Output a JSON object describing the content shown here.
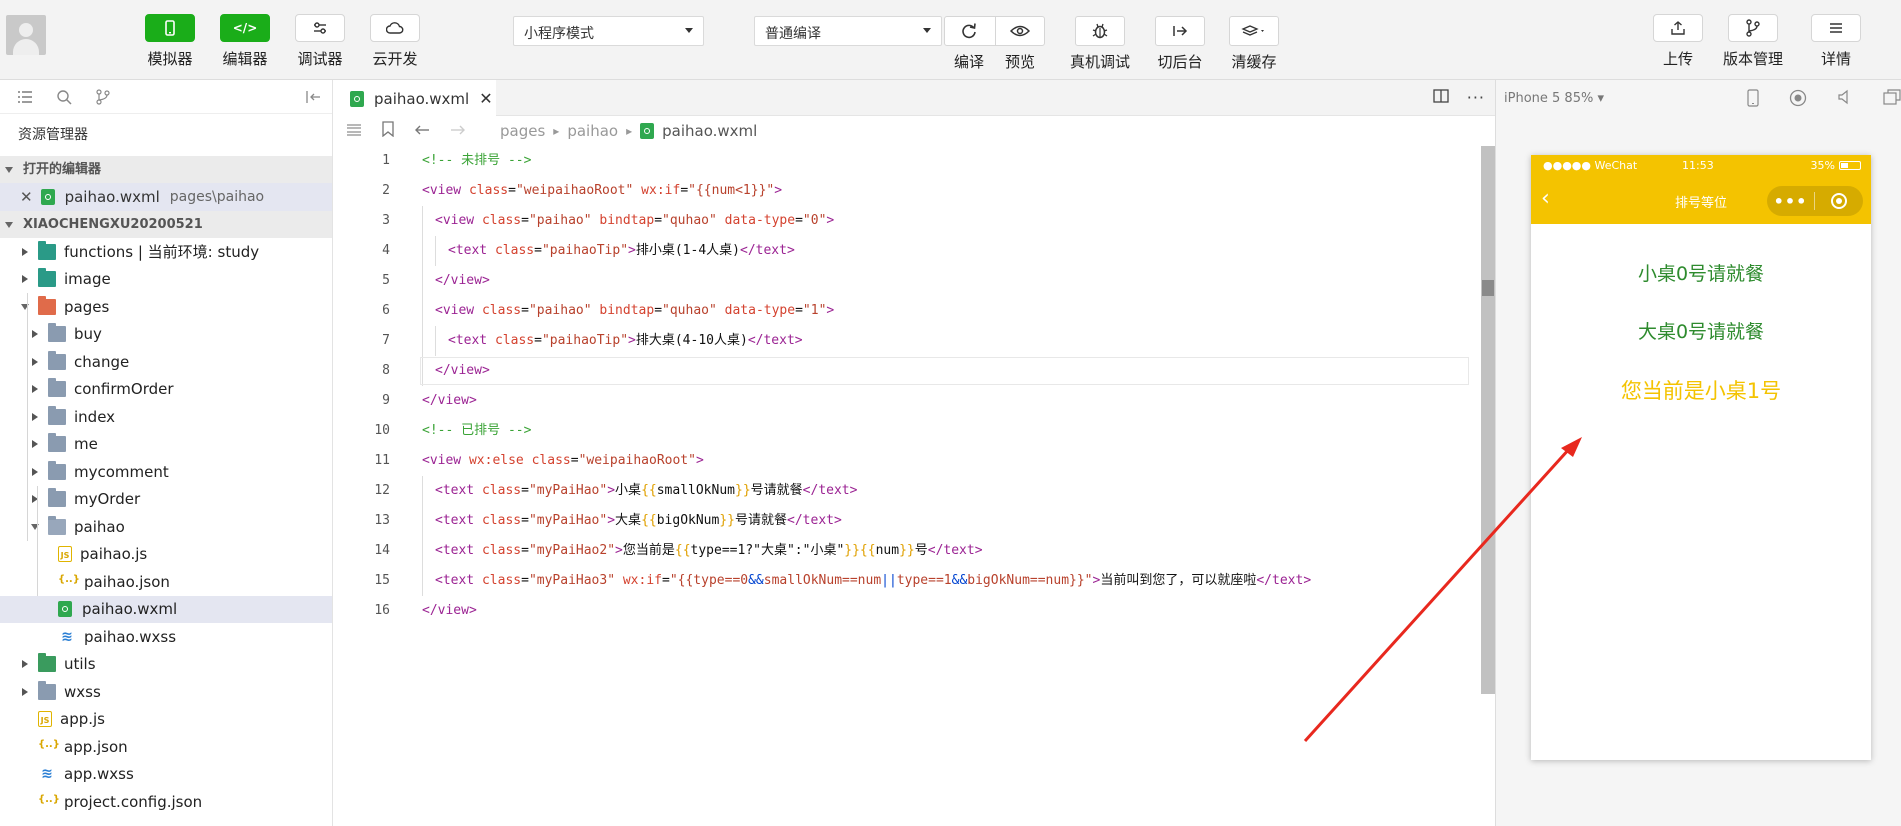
{
  "toolbar": {
    "mode_buttons": [
      {
        "label": "模拟器",
        "icon": "phone-icon"
      },
      {
        "label": "编辑器",
        "icon": "code-icon"
      },
      {
        "label": "调试器",
        "icon": "debug-sliders-icon"
      },
      {
        "label": "云开发",
        "icon": "cloud-icon"
      }
    ],
    "mode_select": "小程序模式",
    "compile_select": "普通编译",
    "actions": [
      {
        "label": "编译",
        "icon": "refresh-icon"
      },
      {
        "label": "预览",
        "icon": "eye-icon"
      },
      {
        "label": "真机调试",
        "icon": "bug-icon"
      },
      {
        "label": "切后台",
        "icon": "switch-background-icon"
      },
      {
        "label": "清缓存",
        "icon": "layers-icon"
      }
    ],
    "right_buttons": [
      {
        "label": "上传",
        "icon": "upload-icon"
      },
      {
        "label": "版本管理",
        "icon": "branch-icon"
      },
      {
        "label": "详情",
        "icon": "menu-icon"
      }
    ],
    "accent_color": "#1aad19"
  },
  "sidebar": {
    "title": "资源管理器",
    "open_editors_label": "打开的编辑器",
    "open_editor": {
      "name": "paihao.wxml",
      "path": "pages\\paihao"
    },
    "project_label": "XIAOCHENGXU20200521",
    "tree": [
      {
        "name": "functions | 当前环境: study",
        "kind": "folder-teal",
        "depth": 0,
        "expanded": false
      },
      {
        "name": "image",
        "kind": "folder-teal",
        "depth": 0,
        "expanded": false
      },
      {
        "name": "pages",
        "kind": "folder-orange",
        "depth": 0,
        "expanded": true
      },
      {
        "name": "buy",
        "kind": "folder",
        "depth": 1,
        "expanded": false
      },
      {
        "name": "change",
        "kind": "folder",
        "depth": 1,
        "expanded": false
      },
      {
        "name": "confirmOrder",
        "kind": "folder",
        "depth": 1,
        "expanded": false
      },
      {
        "name": "index",
        "kind": "folder",
        "depth": 1,
        "expanded": false
      },
      {
        "name": "me",
        "kind": "folder",
        "depth": 1,
        "expanded": false
      },
      {
        "name": "mycomment",
        "kind": "folder",
        "depth": 1,
        "expanded": false
      },
      {
        "name": "myOrder",
        "kind": "folder",
        "depth": 1,
        "expanded": false
      },
      {
        "name": "paihao",
        "kind": "folder-open",
        "depth": 1,
        "expanded": true
      },
      {
        "name": "paihao.js",
        "kind": "js",
        "depth": 2
      },
      {
        "name": "paihao.json",
        "kind": "json",
        "depth": 2
      },
      {
        "name": "paihao.wxml",
        "kind": "wxml",
        "depth": 2,
        "selected": true
      },
      {
        "name": "paihao.wxss",
        "kind": "wxss",
        "depth": 2
      },
      {
        "name": "utils",
        "kind": "folder-green",
        "depth": 0,
        "expanded": false
      },
      {
        "name": "wxss",
        "kind": "folder",
        "depth": 0,
        "expanded": false
      },
      {
        "name": "app.js",
        "kind": "js",
        "depth": 0
      },
      {
        "name": "app.json",
        "kind": "json",
        "depth": 0
      },
      {
        "name": "app.wxss",
        "kind": "wxss",
        "depth": 0
      },
      {
        "name": "project.config.json",
        "kind": "json",
        "depth": 0
      }
    ]
  },
  "editor": {
    "tab": "paihao.wxml",
    "breadcrumb": [
      "pages",
      "paihao",
      "paihao.wxml"
    ],
    "lines": [
      [
        [
          "cmt",
          "<!-- 未排号 -->"
        ]
      ],
      [
        [
          "tag",
          "<view "
        ],
        [
          "aname",
          "class"
        ],
        [
          "txt",
          "="
        ],
        [
          "str",
          "\"weipaihaoRoot\""
        ],
        [
          "txt",
          " "
        ],
        [
          "aname",
          "wx:if"
        ],
        [
          "txt",
          "="
        ],
        [
          "str",
          "\"{{num<1}}\""
        ],
        [
          "tag",
          ">"
        ]
      ],
      [
        [
          "ind",
          ""
        ],
        [
          "tag",
          "<view "
        ],
        [
          "aname",
          "class"
        ],
        [
          "txt",
          "="
        ],
        [
          "str",
          "\"paihao\""
        ],
        [
          "txt",
          " "
        ],
        [
          "aname",
          "bindtap"
        ],
        [
          "txt",
          "="
        ],
        [
          "str",
          "\"quhao\""
        ],
        [
          "txt",
          " "
        ],
        [
          "aname",
          "data-type"
        ],
        [
          "txt",
          "="
        ],
        [
          "str",
          "\"0\""
        ],
        [
          "tag",
          ">"
        ]
      ],
      [
        [
          "ind",
          ""
        ],
        [
          "ind",
          ""
        ],
        [
          "tag",
          "<text "
        ],
        [
          "aname",
          "class"
        ],
        [
          "txt",
          "="
        ],
        [
          "str",
          "\"paihaoTip\""
        ],
        [
          "tag",
          ">"
        ],
        [
          "txt",
          "排小桌(1-4人桌)"
        ],
        [
          "tag",
          "</text>"
        ]
      ],
      [
        [
          "ind",
          ""
        ],
        [
          "tag",
          "</view>"
        ]
      ],
      [
        [
          "ind",
          ""
        ],
        [
          "tag",
          "<view "
        ],
        [
          "aname",
          "class"
        ],
        [
          "txt",
          "="
        ],
        [
          "str",
          "\"paihao\""
        ],
        [
          "txt",
          " "
        ],
        [
          "aname",
          "bindtap"
        ],
        [
          "txt",
          "="
        ],
        [
          "str",
          "\"quhao\""
        ],
        [
          "txt",
          " "
        ],
        [
          "aname",
          "data-type"
        ],
        [
          "txt",
          "="
        ],
        [
          "str",
          "\"1\""
        ],
        [
          "tag",
          ">"
        ]
      ],
      [
        [
          "ind",
          ""
        ],
        [
          "ind",
          ""
        ],
        [
          "tag",
          "<text "
        ],
        [
          "aname",
          "class"
        ],
        [
          "txt",
          "="
        ],
        [
          "str",
          "\"paihaoTip\""
        ],
        [
          "tag",
          ">"
        ],
        [
          "txt",
          "排大桌(4-10人桌)"
        ],
        [
          "tag",
          "</text>"
        ]
      ],
      [
        [
          "ind",
          ""
        ],
        [
          "tag",
          "</view>"
        ]
      ],
      [
        [
          "tag",
          "</view>"
        ]
      ],
      [
        [
          "cmt",
          "<!-- 已排号 -->"
        ]
      ],
      [
        [
          "tag",
          "<view "
        ],
        [
          "aname",
          "wx:else"
        ],
        [
          "txt",
          " "
        ],
        [
          "aname",
          "class"
        ],
        [
          "txt",
          "="
        ],
        [
          "str",
          "\"weipaihaoRoot\""
        ],
        [
          "tag",
          ">"
        ]
      ],
      [
        [
          "ind",
          ""
        ],
        [
          "tag",
          "<text "
        ],
        [
          "aname",
          "class"
        ],
        [
          "txt",
          "="
        ],
        [
          "str",
          "\"myPaiHao\""
        ],
        [
          "tag",
          ">"
        ],
        [
          "txt",
          "小桌"
        ],
        [
          "br",
          "{{"
        ],
        [
          "txt",
          "smallOkNum"
        ],
        [
          "br",
          "}}"
        ],
        [
          "txt",
          "号请就餐"
        ],
        [
          "tag",
          "</text>"
        ]
      ],
      [
        [
          "ind",
          ""
        ],
        [
          "tag",
          "<text "
        ],
        [
          "aname",
          "class"
        ],
        [
          "txt",
          "="
        ],
        [
          "str",
          "\"myPaiHao\""
        ],
        [
          "tag",
          ">"
        ],
        [
          "txt",
          "大桌"
        ],
        [
          "br",
          "{{"
        ],
        [
          "txt",
          "bigOkNum"
        ],
        [
          "br",
          "}}"
        ],
        [
          "txt",
          "号请就餐"
        ],
        [
          "tag",
          "</text>"
        ]
      ],
      [
        [
          "ind",
          ""
        ],
        [
          "tag",
          "<text "
        ],
        [
          "aname",
          "class"
        ],
        [
          "txt",
          "="
        ],
        [
          "str",
          "\"myPaiHao2\""
        ],
        [
          "tag",
          ">"
        ],
        [
          "txt",
          "您当前是"
        ],
        [
          "br",
          "{{"
        ],
        [
          "txt",
          "type==1?\"大桌\":\"小桌\""
        ],
        [
          "br",
          "}}{{"
        ],
        [
          "txt",
          "num"
        ],
        [
          "br",
          "}}"
        ],
        [
          "txt",
          "号"
        ],
        [
          "tag",
          "</text>"
        ]
      ],
      [
        [
          "ind",
          ""
        ],
        [
          "tag",
          "<text "
        ],
        [
          "aname",
          "class"
        ],
        [
          "txt",
          "="
        ],
        [
          "str",
          "\"myPaiHao3\""
        ],
        [
          "txt",
          " "
        ],
        [
          "aname",
          "wx:if"
        ],
        [
          "txt",
          "="
        ],
        [
          "str",
          "\"{{type==0"
        ],
        [
          "op",
          "&&"
        ],
        [
          "str",
          "smallOkNum==num"
        ],
        [
          "op",
          "||"
        ],
        [
          "str",
          "type==1"
        ],
        [
          "op",
          "&&"
        ],
        [
          "str",
          "bigOkNum==num}}\""
        ],
        [
          "tag",
          ">"
        ],
        [
          "txt",
          "当前叫到您了，可以就座啦"
        ],
        [
          "tag",
          "</text>"
        ]
      ],
      [
        [
          "tag",
          "</view>"
        ]
      ]
    ],
    "active_line": 8
  },
  "simulator": {
    "device": "iPhone 5 85%",
    "status_left": "●●●●● WeChat",
    "status_time": "11:53",
    "status_battery": "35%",
    "nav_title": "排号等位",
    "texts": [
      {
        "text": "小桌0号请就餐",
        "color": "#2e8b2e"
      },
      {
        "text": "大桌0号请就餐",
        "color": "#2e8b2e"
      },
      {
        "text": "您当前是小桌1号",
        "color": "#f4c300"
      }
    ],
    "nav_color": "#f4c300"
  },
  "annotation": {
    "color": "#e8281e"
  }
}
